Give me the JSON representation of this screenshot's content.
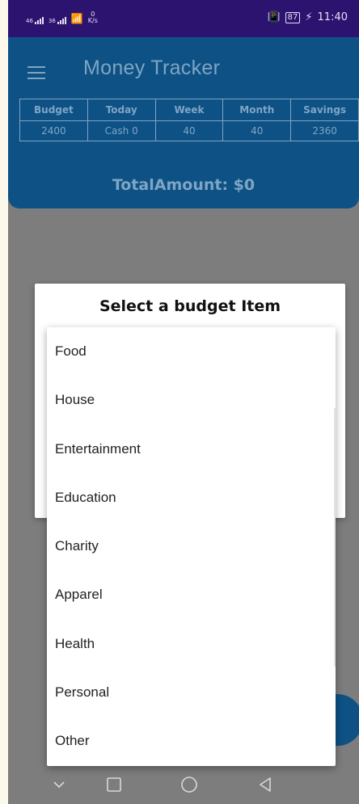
{
  "status_bar": {
    "signal_1": "46",
    "signal_2": "36",
    "speed_value": "0",
    "speed_unit": "K/s",
    "battery": "87",
    "time": "11:40"
  },
  "app_bar": {
    "title": "Money Tracker",
    "menu_icon": "hamburger-menu-icon"
  },
  "summary": {
    "headers": [
      "Budget",
      "Today",
      "Week",
      "Month",
      "Savings"
    ],
    "values": [
      "2400",
      "Cash 0",
      "40",
      "40",
      "2360"
    ]
  },
  "total_amount": "TotalAmount: $0",
  "dialog": {
    "title": "Select a budget Item"
  },
  "dropdown": {
    "options": [
      "Food",
      "House",
      "Entertainment",
      "Education",
      "Charity",
      "Apparel",
      "Health",
      "Personal",
      "Other"
    ]
  },
  "colors": {
    "status_bar": "#2c1370",
    "app_bar": "#0d5185",
    "app_bar_text": "#7fa5c4",
    "scrim": "#7d7d7d"
  },
  "nav_bar": {
    "icons": [
      "chevron-down-icon",
      "recents-square-icon",
      "home-circle-icon",
      "back-triangle-icon"
    ]
  }
}
